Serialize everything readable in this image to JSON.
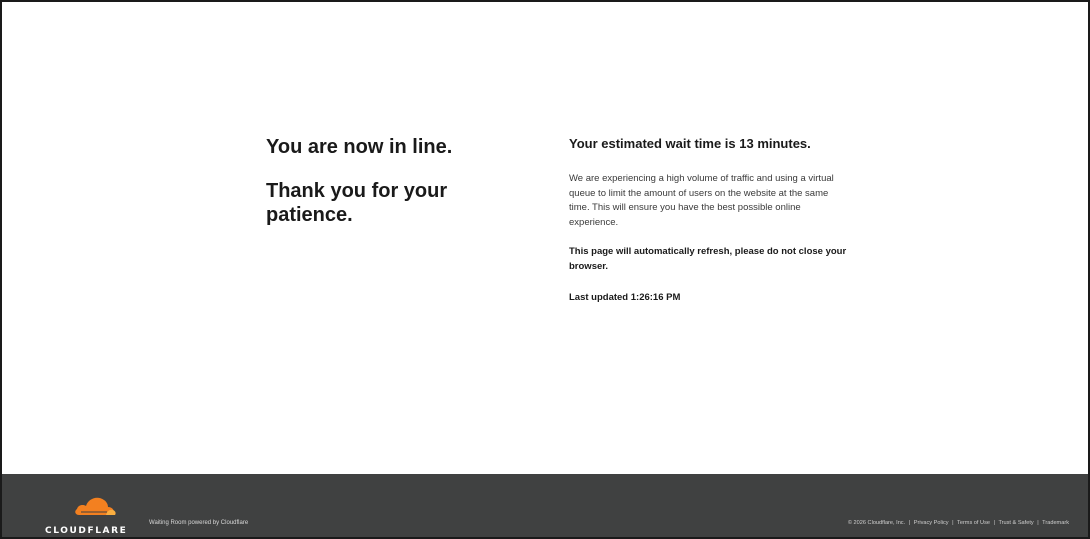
{
  "main": {
    "heading_line1": "You are now in line.",
    "heading_line2": "Thank you for your patience.",
    "wait_time": "Your estimated wait time is 13 minutes.",
    "description": "We are experiencing a high volume of traffic and using a virtual queue to limit the amount of users on the website at the same time. This will ensure you have the best possible online experience.",
    "refresh_note": "This page will automatically refresh, please do not close your browser.",
    "last_updated": "Last updated 1:26:16 PM"
  },
  "footer": {
    "brand_name": "CLOUDFLARE",
    "powered_by": "Waiting Room powered by Cloudflare",
    "copyright": "© 2026 Cloudflare, Inc.",
    "links": {
      "privacy": "Privacy Policy",
      "terms": "Terms of Use",
      "trust": "Trust & Safety",
      "trademark": "Trademark"
    },
    "separator": "|",
    "icon": "cloudflare-cloud-icon",
    "colors": {
      "background": "#404141",
      "cloud_orange": "#f38020",
      "cloud_light": "#faae40"
    }
  }
}
